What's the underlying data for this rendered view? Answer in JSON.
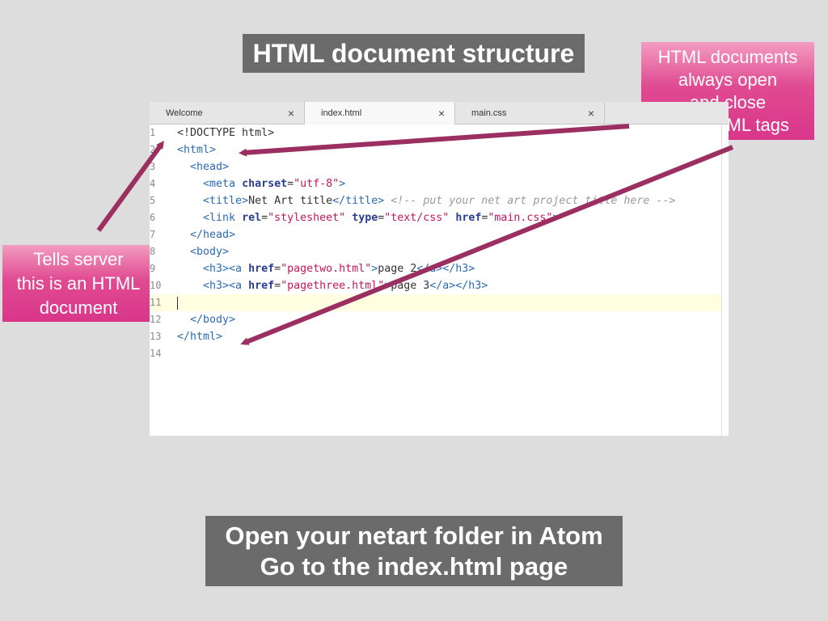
{
  "slide": {
    "title": "HTML document structure",
    "footer_line1": "Open your netart folder in Atom",
    "footer_line2": "Go to the index.html page"
  },
  "callouts": {
    "right": [
      "HTML documents",
      "always open",
      "and close",
      "with HTML tags"
    ],
    "left": [
      "Tells server",
      "this is an HTML",
      "document"
    ]
  },
  "editor": {
    "tabs": [
      {
        "label": "Welcome",
        "close": "×"
      },
      {
        "label": "index.html",
        "close": "×"
      },
      {
        "label": "main.css",
        "close": "×"
      }
    ],
    "active_tab": "index.html",
    "cursor_line": 11,
    "lines": [
      {
        "num": "1",
        "tokens": [
          {
            "t": "<!DOCTYPE html>",
            "c": "txt"
          }
        ]
      },
      {
        "num": "2",
        "tokens": [
          {
            "t": "<html>",
            "c": "tag"
          }
        ]
      },
      {
        "num": "3",
        "tokens": [
          {
            "t": "  <head>",
            "c": "tag"
          }
        ]
      },
      {
        "num": "4",
        "tokens": [
          {
            "t": "    <meta ",
            "c": "tag"
          },
          {
            "t": "charset",
            "c": "attr"
          },
          {
            "t": "=",
            "c": "txt"
          },
          {
            "t": "\"utf-8\"",
            "c": "str"
          },
          {
            "t": ">",
            "c": "tag"
          }
        ]
      },
      {
        "num": "5",
        "tokens": [
          {
            "t": "    <title>",
            "c": "tag"
          },
          {
            "t": "Net Art title",
            "c": "txt"
          },
          {
            "t": "</title>",
            "c": "tag"
          },
          {
            "t": " ",
            "c": "txt"
          },
          {
            "t": "<!-- put your net art project title here -->",
            "c": "com"
          }
        ]
      },
      {
        "num": "6",
        "tokens": [
          {
            "t": "    <link ",
            "c": "tag"
          },
          {
            "t": "rel",
            "c": "attr"
          },
          {
            "t": "=",
            "c": "txt"
          },
          {
            "t": "\"stylesheet\"",
            "c": "str"
          },
          {
            "t": " ",
            "c": "txt"
          },
          {
            "t": "type",
            "c": "attr"
          },
          {
            "t": "=",
            "c": "txt"
          },
          {
            "t": "\"text/css\"",
            "c": "str"
          },
          {
            "t": " ",
            "c": "txt"
          },
          {
            "t": "href",
            "c": "attr"
          },
          {
            "t": "=",
            "c": "txt"
          },
          {
            "t": "\"main.css\"",
            "c": "str"
          },
          {
            "t": ">",
            "c": "tag"
          }
        ]
      },
      {
        "num": "7",
        "tokens": [
          {
            "t": "  </head>",
            "c": "tag"
          }
        ]
      },
      {
        "num": "8",
        "tokens": [
          {
            "t": "  <body>",
            "c": "tag"
          }
        ]
      },
      {
        "num": "9",
        "tokens": [
          {
            "t": "    <h3><a ",
            "c": "tag"
          },
          {
            "t": "href",
            "c": "attr"
          },
          {
            "t": "=",
            "c": "txt"
          },
          {
            "t": "\"pagetwo.html\"",
            "c": "str"
          },
          {
            "t": ">",
            "c": "tag"
          },
          {
            "t": "page 2",
            "c": "txt"
          },
          {
            "t": "</a></h3>",
            "c": "tag"
          }
        ]
      },
      {
        "num": "10",
        "tokens": [
          {
            "t": "    <h3><a ",
            "c": "tag"
          },
          {
            "t": "href",
            "c": "attr"
          },
          {
            "t": "=",
            "c": "txt"
          },
          {
            "t": "\"pagethree.html\"",
            "c": "str"
          },
          {
            "t": ">",
            "c": "tag"
          },
          {
            "t": "page 3",
            "c": "txt"
          },
          {
            "t": "</a></h3>",
            "c": "tag"
          }
        ]
      },
      {
        "num": "11",
        "tokens": []
      },
      {
        "num": "12",
        "tokens": [
          {
            "t": "  </body>",
            "c": "tag"
          }
        ]
      },
      {
        "num": "13",
        "tokens": [
          {
            "t": "</html>",
            "c": "tag"
          }
        ]
      },
      {
        "num": "14",
        "tokens": []
      }
    ]
  },
  "colors": {
    "background": "#dddddd",
    "label_box": "#6b6b6b",
    "callout_pink": "#e04b92",
    "arrow": "#9b2f62",
    "current_line": "#fffee0"
  }
}
